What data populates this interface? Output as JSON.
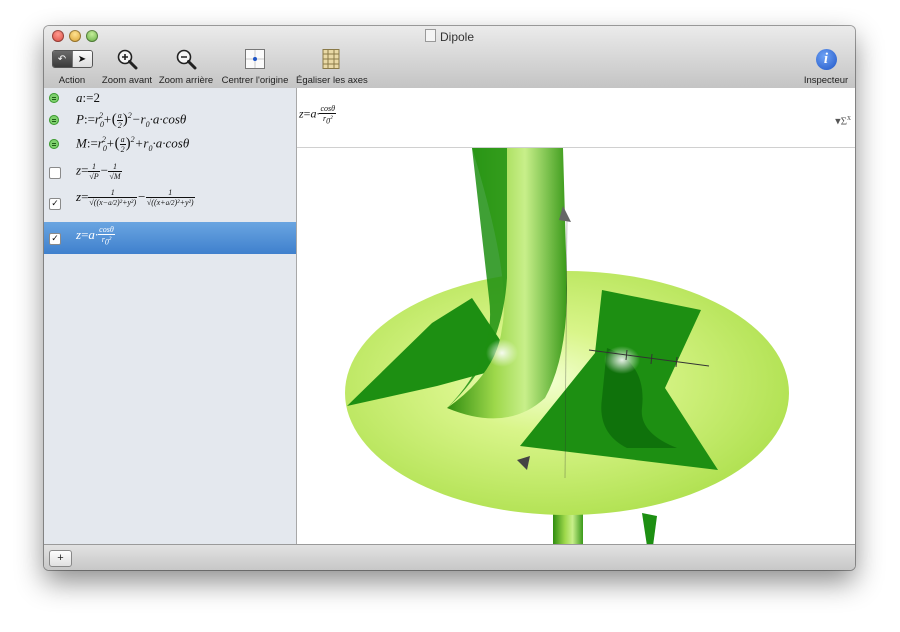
{
  "window": {
    "title": "Dipole"
  },
  "toolbar": {
    "action_label": "Action",
    "zoom_in_label": "Zoom avant",
    "zoom_out_label": "Zoom arrière",
    "center_origin_label": "Centrer l'origine",
    "equalize_axes_label": "Égaliser les axes",
    "inspector_label": "Inspecteur"
  },
  "equations": [
    {
      "kind": "definition",
      "checked": false,
      "lhs": "a",
      "op": ":=",
      "rhs": "2"
    },
    {
      "kind": "definition",
      "checked": false,
      "lhs": "P",
      "op": ":=",
      "text": "r0²+(a/2)²−r0·a·cosθ"
    },
    {
      "kind": "definition",
      "checked": false,
      "lhs": "M",
      "op": ":=",
      "text": "r0²+(a/2)²+r0·a·cosθ"
    },
    {
      "kind": "surface",
      "checked": false,
      "lhs": "z",
      "op": "=",
      "text": "1/√P − 1/√M"
    },
    {
      "kind": "surface",
      "checked": true,
      "lhs": "z",
      "op": "=",
      "text": "1/√((x−a/2)²+y²) − 1/√((x+a/2)²+y²)"
    },
    {
      "kind": "surface",
      "checked": true,
      "selected": true,
      "lhs": "z",
      "op": "=",
      "text": "a·cosθ/r0²"
    }
  ],
  "current_formula": {
    "lhs": "z",
    "op": "=",
    "text": "a·cosθ/r0²"
  },
  "colors": {
    "selection": "#3f80cd",
    "surface_dark": "#1d8f12",
    "surface_light": "#d2f27e",
    "tube": "#4fa81e"
  },
  "icons": {
    "sum": "sum-icon",
    "add": "plus-icon",
    "inspector": "info-icon"
  }
}
